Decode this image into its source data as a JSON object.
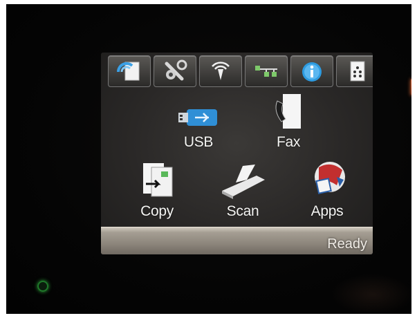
{
  "screen": {
    "toolbar": [
      {
        "icon": "web-services-icon"
      },
      {
        "icon": "setup-icon"
      },
      {
        "icon": "wireless-icon"
      },
      {
        "icon": "network-icon"
      },
      {
        "icon": "info-icon"
      },
      {
        "icon": "supplies-icon"
      }
    ],
    "apps": {
      "usb": "USB",
      "fax": "Fax",
      "copy": "Copy",
      "scan": "Scan",
      "apps": "Apps"
    },
    "status": "Ready"
  },
  "colors": {
    "screen_bg": "#2a2827",
    "status_bar": "#8c857b",
    "power_led": "#2fa83c"
  }
}
